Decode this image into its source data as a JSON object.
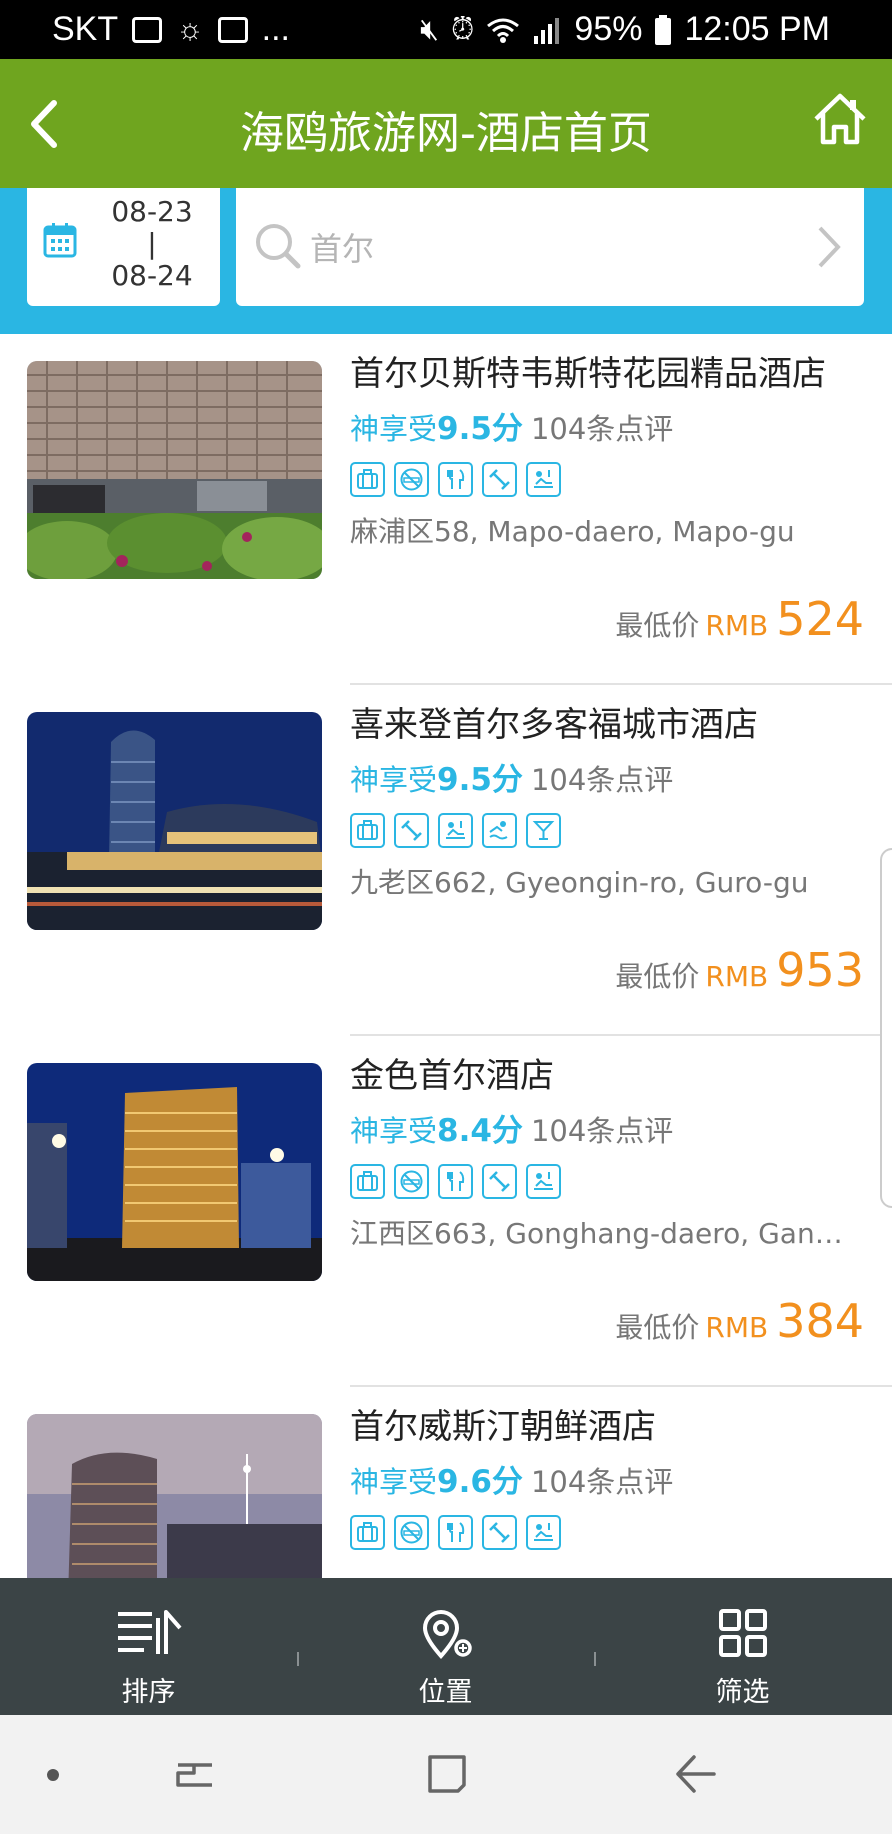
{
  "status_bar": {
    "carrier": "SKT",
    "dots": "...",
    "battery": "95%",
    "time": "12:05 PM"
  },
  "title_bar": {
    "title": "海鸥旅游网-酒店首页"
  },
  "search": {
    "check_in": "08-23",
    "date_sep": "|",
    "check_out": "08-24",
    "query": "首尔"
  },
  "hotels": [
    {
      "name": "首尔贝斯特韦斯特花园精品酒店",
      "rating_label": "神享受",
      "score": "9.5分",
      "reviews": "104条点评",
      "amenities": [
        "luggage-icon",
        "no-smoking-icon",
        "restaurant-icon",
        "gym-icon",
        "spa-icon"
      ],
      "address": "麻浦区58, Mapo-daero, Mapo-gu",
      "price_label": "最低价",
      "currency": "RMB",
      "price": "524"
    },
    {
      "name": "喜来登首尔多客福城市酒店",
      "rating_label": "神享受",
      "score": "9.5分",
      "reviews": "104条点评",
      "amenities": [
        "luggage-icon",
        "gym-icon",
        "spa-icon",
        "pool-icon",
        "bar-icon"
      ],
      "address": "九老区662, Gyeongin-ro, Guro-gu",
      "price_label": "最低价",
      "currency": "RMB",
      "price": "953"
    },
    {
      "name": "金色首尔酒店",
      "rating_label": "神享受",
      "score": "8.4分",
      "reviews": "104条点评",
      "amenities": [
        "luggage-icon",
        "no-smoking-icon",
        "restaurant-icon",
        "gym-icon",
        "spa-icon"
      ],
      "address": "江西区663, Gonghang-daero, Gan…",
      "price_label": "最低价",
      "currency": "RMB",
      "price": "384"
    },
    {
      "name": "首尔威斯汀朝鲜酒店",
      "rating_label": "神享受",
      "score": "9.6分",
      "reviews": "104条点评",
      "amenities": [
        "luggage-icon",
        "no-smoking-icon",
        "restaurant-icon",
        "gym-icon",
        "spa-icon"
      ]
    }
  ],
  "bottom_tabs": [
    {
      "label": "排序"
    },
    {
      "label": "位置"
    },
    {
      "label": "筛选"
    }
  ],
  "colors": {
    "primary_green": "#6fa51f",
    "accent_blue": "#2ab6e3",
    "price_orange": "#f2901e",
    "tab_bar": "#3b4446"
  }
}
